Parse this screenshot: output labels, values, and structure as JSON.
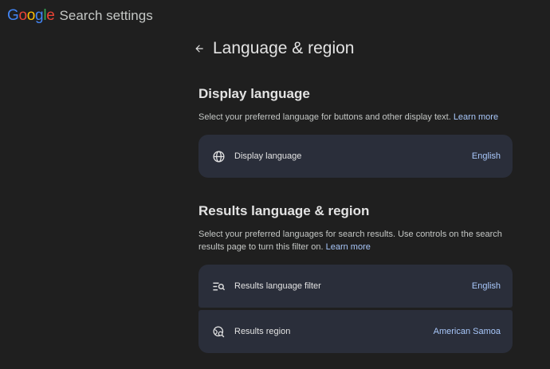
{
  "header": {
    "logo_letters": [
      {
        "char": "G",
        "color": "#4285f4"
      },
      {
        "char": "o",
        "color": "#ea4335"
      },
      {
        "char": "o",
        "color": "#fbbc05"
      },
      {
        "char": "g",
        "color": "#4285f4"
      },
      {
        "char": "l",
        "color": "#34a853"
      },
      {
        "char": "e",
        "color": "#ea4335"
      }
    ],
    "title": "Search settings"
  },
  "page": {
    "title": "Language & region",
    "back_icon": "arrow-left-icon"
  },
  "display_language": {
    "title": "Display language",
    "description": "Select your preferred language for buttons and other display text.",
    "learn_more": "Learn more",
    "item": {
      "icon": "globe-icon",
      "label": "Display language",
      "value": "English"
    }
  },
  "results": {
    "title": "Results language & region",
    "description": "Select your preferred languages for search results. Use controls on the search results page to turn this filter on.",
    "learn_more": "Learn more",
    "items": [
      {
        "icon": "filter-search-icon",
        "label": "Results language filter",
        "value": "English"
      },
      {
        "icon": "location-search-icon",
        "label": "Results region",
        "value": "American Samoa"
      }
    ]
  },
  "colors": {
    "background": "#1f1f1f",
    "card": "#2a2e3a",
    "link": "#a8c7fa"
  }
}
